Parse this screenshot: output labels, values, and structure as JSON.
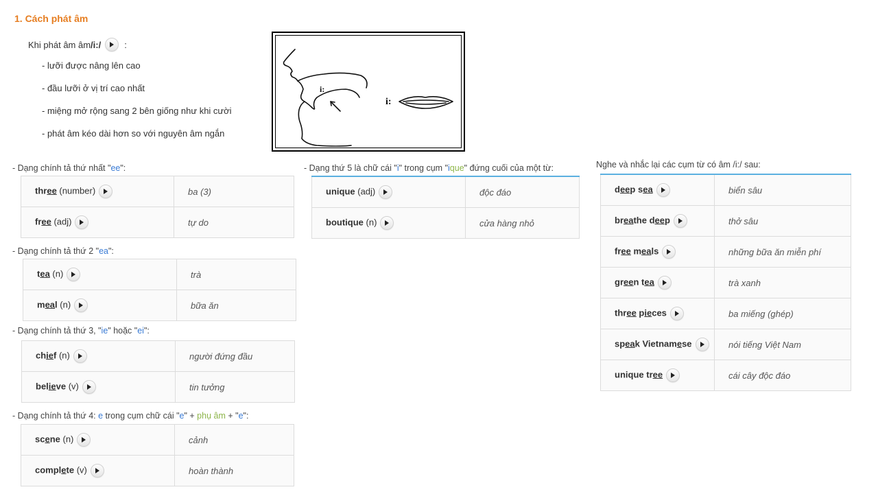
{
  "title": "1. Cách phát âm",
  "intro": {
    "prefix": "Khi phát âm âm ",
    "symbol": "/i:/",
    "suffix": ":"
  },
  "bullets": [
    "- lưỡi được nâng lên cao",
    "- đầu lưỡi ở vị trí cao nhất",
    "- miệng mở rộng sang 2 bên giống như khi cười",
    "- phát âm kéo dài hơn so với nguyên âm ngắn"
  ],
  "diagram": {
    "label_left": "i:",
    "label_right": "i:"
  },
  "sections": {
    "s1": {
      "pre": "- Dạng chính tả thứ nhất \"",
      "hl": "ee",
      "post": "\":"
    },
    "s2": {
      "pre": "- Dạng chính tả thứ 2 \"",
      "hl": "ea",
      "post": "\":"
    },
    "s3": {
      "pre": "- Dạng chính tả thứ 3, \"",
      "hl1": "ie",
      "mid": "\" hoặc \"",
      "hl2": "ei",
      "post": "\":"
    },
    "s4": {
      "pre": "- Dạng chính tả thứ 4: ",
      "e1": "e",
      "mid1": " trong cụm chữ cái \"",
      "e2": "e",
      "mid2": "\" + ",
      "pa": "phụ âm",
      "mid3": " + \"",
      "e3": "e",
      "post": "\":"
    },
    "s5": {
      "pre": "- Dạng thứ 5 là chữ cái \"",
      "i": "i",
      "mid": "\" trong cụm \"",
      "ique_i": "i",
      "ique_rest": "que",
      "post": "\" đứng cuối của một từ:"
    },
    "s6": {
      "text": "Nghe và nhắc lại các cụm từ có âm /i:/ sau:"
    }
  },
  "t1": [
    {
      "w": [
        "thr",
        "ee",
        ""
      ],
      "pos": " (number)",
      "m": "ba (3)"
    },
    {
      "w": [
        "fr",
        "ee",
        ""
      ],
      "pos": " (adj)",
      "m": "tự do"
    }
  ],
  "t2": [
    {
      "w": [
        "t",
        "ea",
        ""
      ],
      "pos": " (n)",
      "m": "trà"
    },
    {
      "w": [
        "m",
        "ea",
        "l"
      ],
      "pos": " (n)",
      "m": "bữa ăn"
    }
  ],
  "t3": [
    {
      "w": [
        "ch",
        "ie",
        "f"
      ],
      "pos": " (n)",
      "m": "người đứng đầu"
    },
    {
      "w": [
        "bel",
        "ie",
        "ve"
      ],
      "pos": " (v)",
      "m": "tin tưởng"
    }
  ],
  "t4": [
    {
      "w": [
        "sc",
        "e",
        "ne"
      ],
      "pos": " (n)",
      "m": "cảnh"
    },
    {
      "w": [
        "compl",
        "e",
        "te"
      ],
      "pos": " (v)",
      "m": "hoàn thành"
    }
  ],
  "t5": [
    {
      "w": [
        "un",
        "i",
        "que"
      ],
      "pos": " (adj)",
      "m": "độc đáo"
    },
    {
      "w": [
        "bout",
        "i",
        "que"
      ],
      "pos": " (n)",
      "m": "cửa hàng nhỏ"
    }
  ],
  "t6": [
    {
      "p": [
        "d",
        "ee",
        "p s",
        "ea",
        ""
      ],
      "m": "biển sâu"
    },
    {
      "p": [
        "br",
        "ea",
        "the d",
        "ee",
        "p"
      ],
      "m": "thở sâu"
    },
    {
      "p": [
        "fr",
        "ee",
        " m",
        "ea",
        "ls"
      ],
      "m": "những bữa ăn miễn phí"
    },
    {
      "p": [
        "gr",
        "ee",
        "n t",
        "ea",
        ""
      ],
      "m": "trà xanh"
    },
    {
      "p": [
        "thr",
        "ee",
        " p",
        "ie",
        "ces"
      ],
      "m": "ba miếng (ghép)"
    },
    {
      "p": [
        "sp",
        "ea",
        "k Vietnam",
        "e",
        "se"
      ],
      "m": "nói tiếng Việt Nam"
    },
    {
      "p": [
        "un",
        "i",
        "que tr",
        "ee",
        ""
      ],
      "m": "cái cây độc đáo"
    }
  ]
}
